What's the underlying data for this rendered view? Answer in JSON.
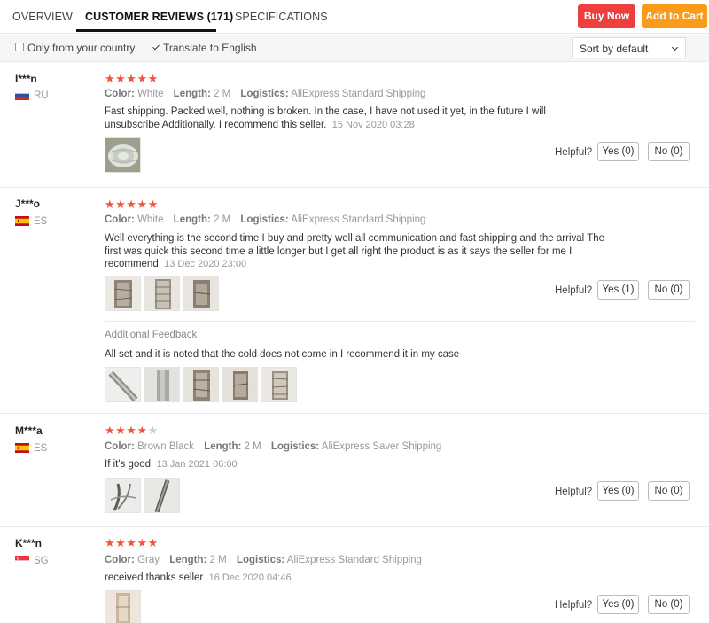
{
  "tabs": [
    {
      "label": "OVERVIEW"
    },
    {
      "label": "CUSTOMER REVIEWS (171)"
    },
    {
      "label": "SPECIFICATIONS"
    }
  ],
  "actions": {
    "buy_now": "Buy Now",
    "add_to_cart": "Add to Cart"
  },
  "colors": {
    "buy_now": "#ee3f3f",
    "add_to_cart": "#fb9b1a",
    "star": "#f0543c"
  },
  "filters": {
    "only_country": {
      "label": "Only from your country",
      "checked": false
    },
    "translate": {
      "label": "Translate to English",
      "checked": true
    },
    "sort": {
      "selected": "Sort by default"
    }
  },
  "helpful_label": "Helpful?",
  "attr_labels": {
    "color": "Color:",
    "length": "Length:",
    "logistics": "Logistics:"
  },
  "reviews": [
    {
      "user": "I***n",
      "country": "RU",
      "stars": 5,
      "color": "White",
      "length": "2 M",
      "logistics": "AliExpress Standard Shipping",
      "text": "Fast shipping. Packed well, nothing is broken. In the case, I have not used it yet, in the future I will unsubscribe Additionally. I recommend this seller.",
      "date": "15 Nov 2020 03:28",
      "yes": "Yes (0)",
      "no": "No (0)"
    },
    {
      "user": "J***o",
      "country": "ES",
      "stars": 5,
      "color": "White",
      "length": "2 M",
      "logistics": "AliExpress Standard Shipping",
      "text": "Well everything is the second time I buy and pretty well all communication and fast shipping and the arrival The first was quick this second time a little longer but I get all right the product is as it says the seller for me I recommend",
      "date": "13 Dec 2020 23:00",
      "yes": "Yes (1)",
      "no": "No (0)",
      "additional_title": "Additional Feedback",
      "additional_text": "All set and it is noted that the cold does not come in I recommend it in my case"
    },
    {
      "user": "M***a",
      "country": "ES",
      "stars": 4,
      "color": "Brown Black",
      "length": "2 M",
      "logistics": "AliExpress Saver Shipping",
      "text": "If it's good",
      "date": "13 Jan 2021 06:00",
      "yes": "Yes (0)",
      "no": "No (0)"
    },
    {
      "user": "K***n",
      "country": "SG",
      "stars": 5,
      "color": "Gray",
      "length": "2 M",
      "logistics": "AliExpress Standard Shipping",
      "text": "received thanks seller",
      "date": "16 Dec 2020 04:46",
      "yes": "Yes (0)",
      "no": "No (0)"
    }
  ]
}
